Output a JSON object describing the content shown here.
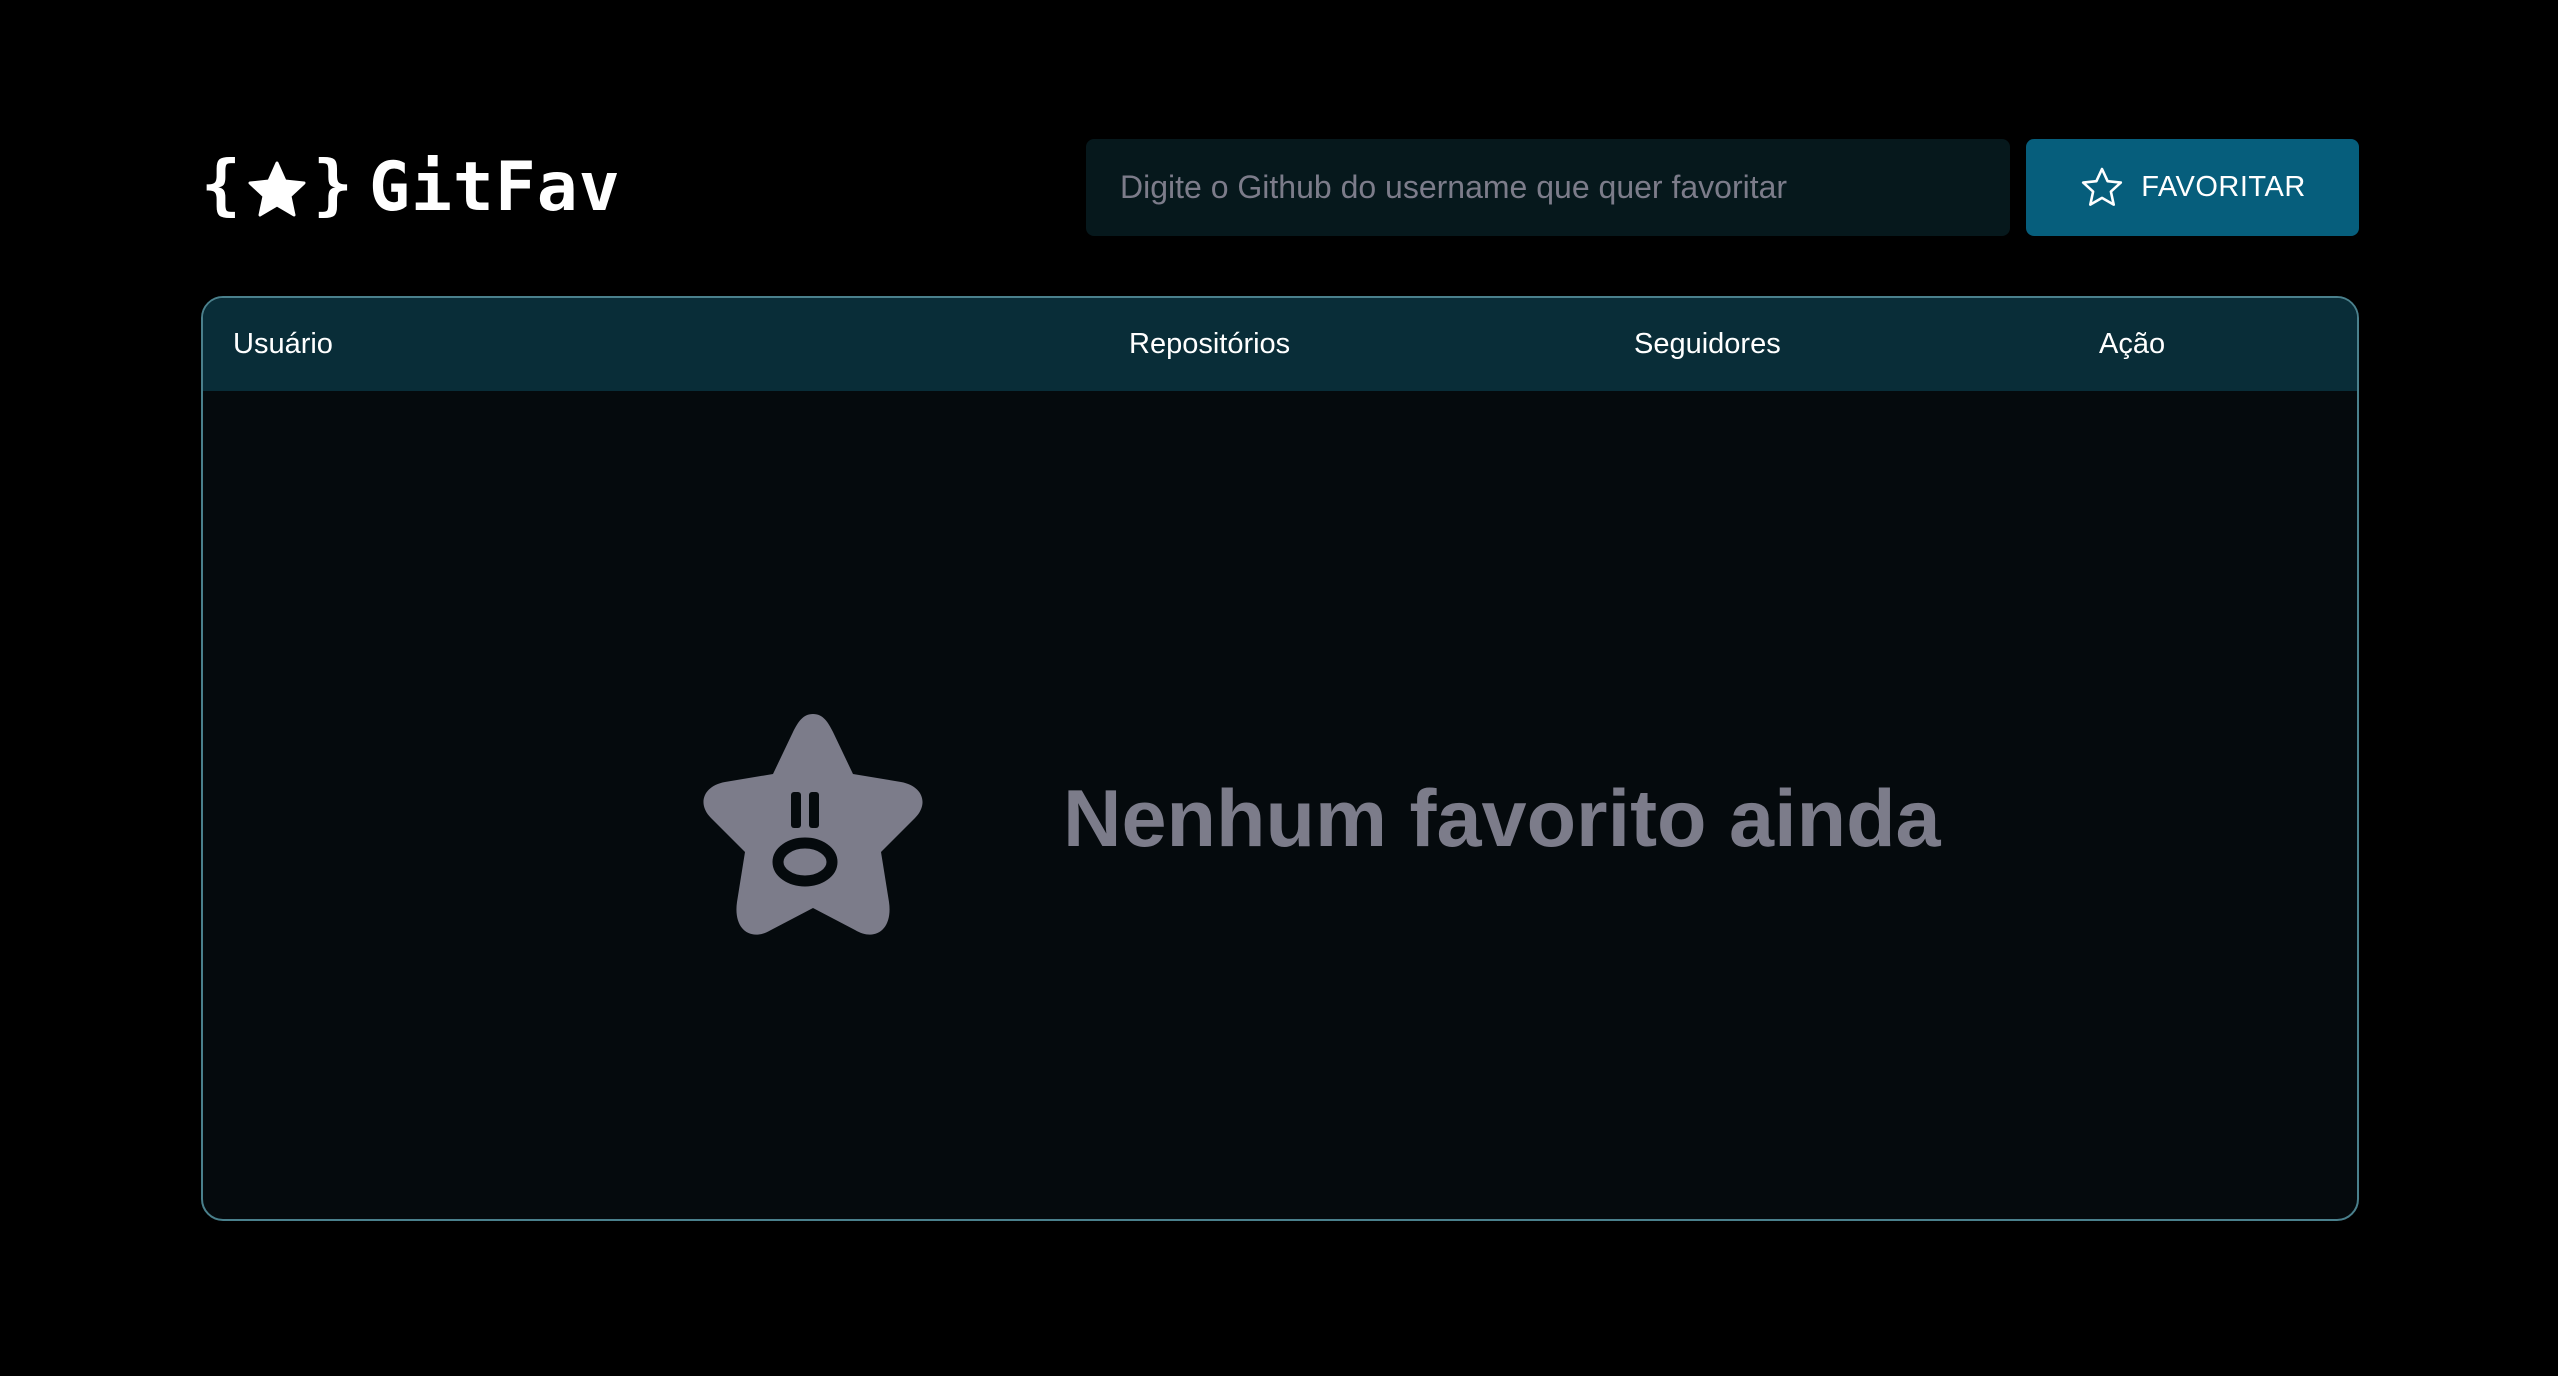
{
  "app": {
    "name": "GitFav"
  },
  "search": {
    "placeholder": "Digite o Github do username que quer favoritar",
    "value": ""
  },
  "favorite_button": {
    "label": "FAVORITAR",
    "icon": "star-outline-icon"
  },
  "table": {
    "columns": [
      "Usuário",
      "Repositórios",
      "Seguidores",
      "Ação"
    ],
    "rows": []
  },
  "empty_state": {
    "icon": "sad-star-icon",
    "message": "Nenhum favorito ainda"
  },
  "colors": {
    "background": "#000000",
    "input_bg": "#06181c",
    "button_bg": "#065e7c",
    "table_header_bg": "#092d38",
    "table_body_bg": "#050a0d",
    "table_border": "#4a808c",
    "muted_text": "#7c7c8a",
    "text": "#ffffff"
  }
}
